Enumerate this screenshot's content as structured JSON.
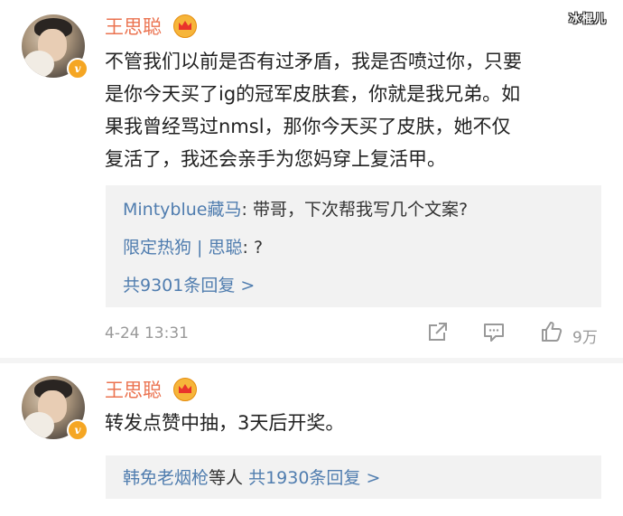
{
  "watermark": "冰棍儿",
  "comments": [
    {
      "username": "王思聪",
      "body": "不管我们以前是否有过矛盾，我是否喷过你，只要\n是你今天买了ig的冠军皮肤套，你就是我兄弟。如\n果我曾经骂过nmsl，那你今天买了皮肤，她不仅\n复活了，我还会亲手为您妈穿上复活甲。",
      "replies": [
        {
          "author": "Mintyblue藏马",
          "text": "带哥，下次帮我写几个文案?"
        },
        {
          "author": "限定热狗",
          "author2": "思聪",
          "text": "?"
        }
      ],
      "more_replies": "共9301条回复 >",
      "time": "4-24 13:31",
      "like_count": "9万",
      "icons": [
        "vip-v-badge",
        "crown-badge",
        "share-icon",
        "comment-icon",
        "thumbs-up-icon"
      ]
    },
    {
      "username": "王思聪",
      "body": "转发点赞中抽，3天后开奖。",
      "replies_summary_author": "韩免老烟枪",
      "replies_summary_mid": "等人",
      "replies_summary_count": "共1930条回复 >"
    }
  ],
  "colors": {
    "username": "#eb7350",
    "link": "#507daf",
    "reply_bg": "#f2f2f2",
    "meta": "#999999"
  }
}
